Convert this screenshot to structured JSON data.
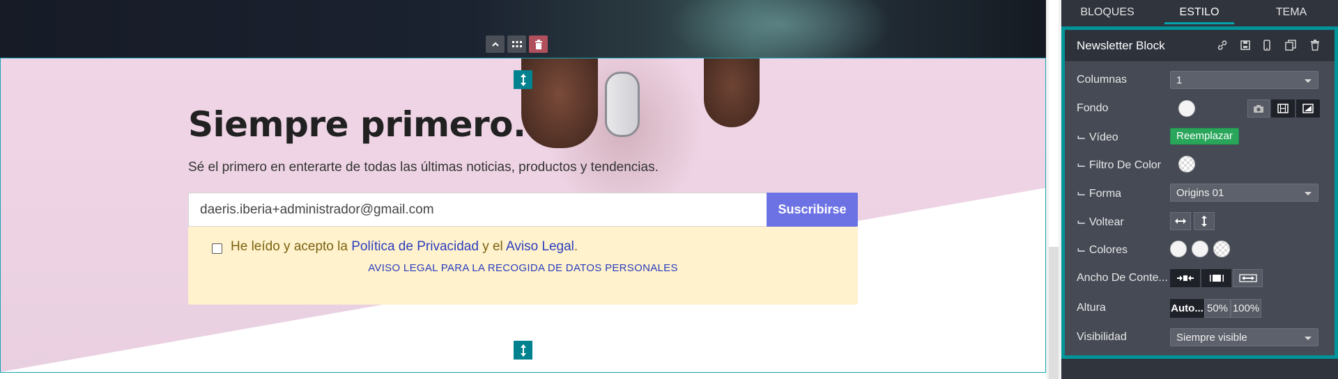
{
  "block_toolbar": {
    "move_up_icon": "chevron-up-icon",
    "drag_icon": "grid-icon",
    "delete_icon": "trash-icon"
  },
  "hero": {
    "title": "Siempre primero.",
    "subtitle": "Sé el primero en enterarte de todas las últimas noticias, productos y tendencias."
  },
  "newsletter": {
    "email_value": "daeris.iberia+administrador@gmail.com",
    "subscribe_label": "Suscribirse",
    "consent_prefix": "He leído y acepto la ",
    "privacy_link": "Política de Privacidad",
    "consent_middle": " y el ",
    "legal_link": "Aviso Legal",
    "consent_suffix": ".",
    "legal_notice": "AVISO LEGAL PARA LA RECOGIDA DE DATOS PERSONALES"
  },
  "panel": {
    "tabs": [
      {
        "label": "BLOQUES",
        "active": false
      },
      {
        "label": "ESTILO",
        "active": true
      },
      {
        "label": "TEMA",
        "active": false
      }
    ],
    "block_title": "Newsletter Block",
    "header_icons": [
      "link-icon",
      "save-icon",
      "mobile-icon",
      "duplicate-icon",
      "trash-icon"
    ],
    "options": {
      "columnas": {
        "label": "Columnas",
        "value": "1"
      },
      "fondo": {
        "label": "Fondo"
      },
      "video": {
        "label": "⌙ Vídeo",
        "button": "Reemplazar"
      },
      "filtro": {
        "label": "⌙ Filtro De Color"
      },
      "forma": {
        "label": "⌙ Forma",
        "value": "Origins 01"
      },
      "voltear": {
        "label": "⌙ Voltear"
      },
      "colores": {
        "label": "⌙ Colores"
      },
      "ancho": {
        "label": "Ancho De Conte..."
      },
      "altura": {
        "label": "Altura",
        "options": [
          "Auto...",
          "50%",
          "100%"
        ],
        "selected": "Auto..."
      },
      "visibilidad": {
        "label": "Visibilidad",
        "value": "Siempre visible"
      }
    }
  },
  "colors": {
    "accent": "#019499",
    "subscribe_button": "#6c72e3",
    "replace_button": "#29a65a",
    "consent_background": "#fff2cc",
    "link": "#2a3dbf"
  }
}
